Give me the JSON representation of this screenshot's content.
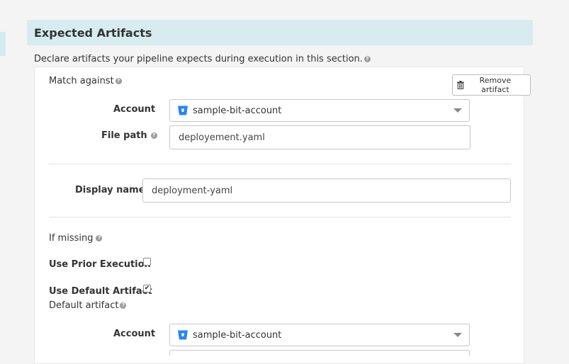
{
  "section": {
    "title": "Expected Artifacts",
    "description": "Declare artifacts your pipeline expects during execution in this section."
  },
  "artifact": {
    "match_against_label": "Match against",
    "remove_button_label": "Remove artifact",
    "account_label": "Account",
    "account_value": "sample-bit-account",
    "file_path_label": "File path",
    "file_path_value": "deployement.yaml",
    "display_name_label": "Display name",
    "display_name_value": "deployment-yaml",
    "if_missing_label": "If missing",
    "use_prior_execution_label": "Use Prior Execution",
    "use_prior_execution_checked": false,
    "use_default_artifact_label": "Use Default Artifact",
    "use_default_artifact_checked": true,
    "default_artifact_label": "Default artifact",
    "default_account_label": "Account",
    "default_account_value": "sample-bit-account"
  },
  "icons": {
    "help": "help-circle-icon",
    "trash": "trash-icon",
    "account_type": "bitbucket-icon",
    "dropdown": "caret-down-icon",
    "check": "check-icon"
  },
  "colors": {
    "header_bg": "#d7ecf0",
    "bitbucket_blue": "#2684ff"
  }
}
